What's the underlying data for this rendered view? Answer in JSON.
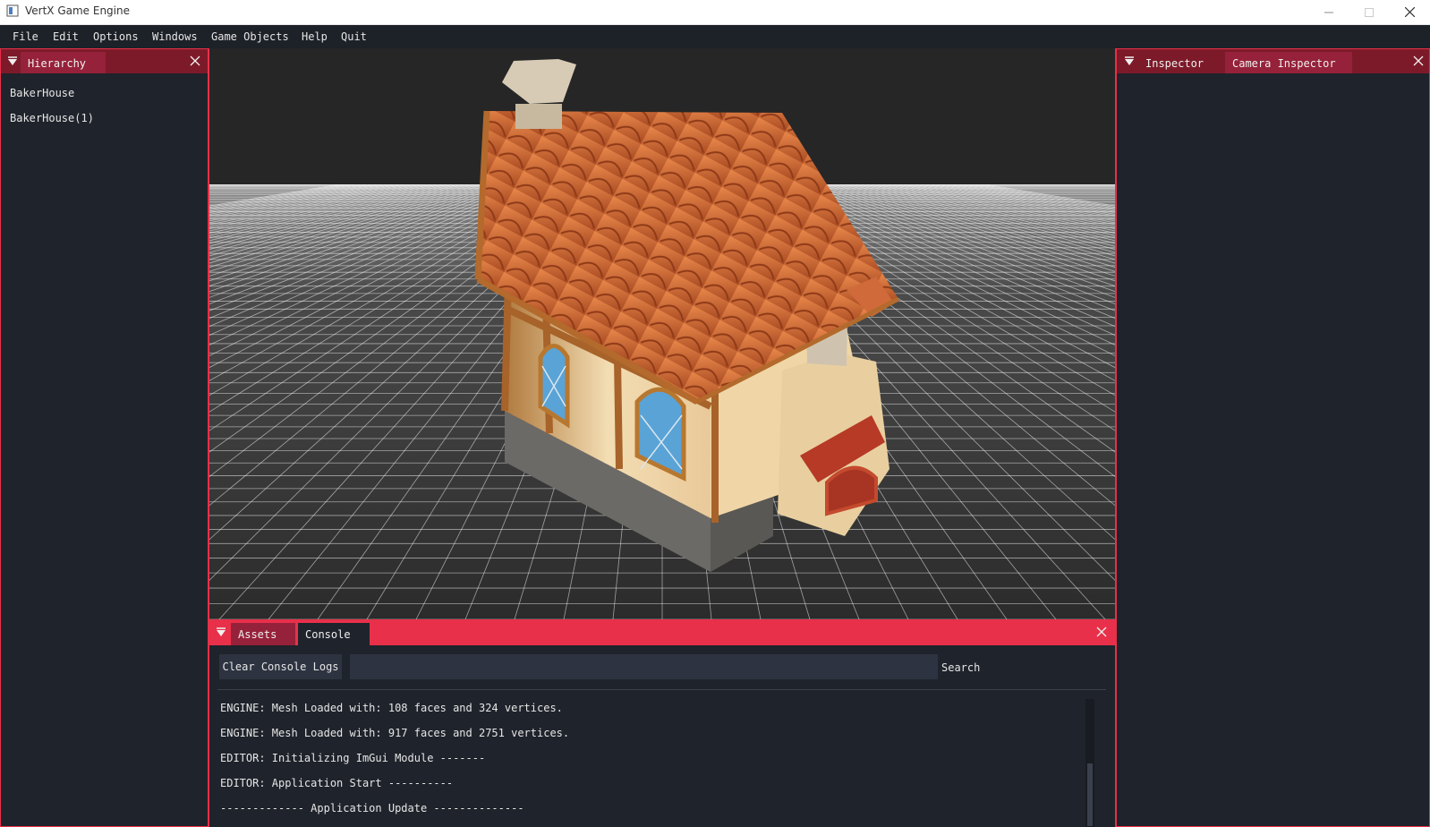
{
  "window": {
    "title": "VertX Game Engine"
  },
  "menu": {
    "items": [
      "File",
      "Edit",
      "Options",
      "Windows",
      "Game Objects",
      "Help",
      "Quit"
    ]
  },
  "hierarchy": {
    "tab_label": "Hierarchy",
    "items": [
      "BakerHouse",
      "BakerHouse(1)"
    ]
  },
  "inspector": {
    "tabs": [
      "Inspector",
      "Camera Inspector"
    ]
  },
  "bottom": {
    "tabs": [
      "Assets",
      "Console"
    ],
    "active_tab": "Console"
  },
  "console": {
    "clear_label": "Clear Console Logs",
    "search_value": "",
    "search_label": "Search",
    "logs": [
      "ENGINE: Mesh Loaded with: 108 faces and 324 vertices.",
      "ENGINE: Mesh Loaded with: 917 faces and 2751 vertices.",
      "EDITOR: Initializing ImGui Module -------",
      "EDITOR: Application Start ----------",
      "------------- Application Update --------------"
    ]
  },
  "colors": {
    "accent": "#e8304a",
    "tab_bar": "#7d1a29",
    "panel_bg": "#1f232b",
    "sky": "#262626",
    "ground": "#8a8a8a"
  },
  "icons": [
    "app-icon",
    "minimize-icon",
    "maximize-icon",
    "window-close-icon",
    "collapse-triangle-icon",
    "close-icon"
  ]
}
